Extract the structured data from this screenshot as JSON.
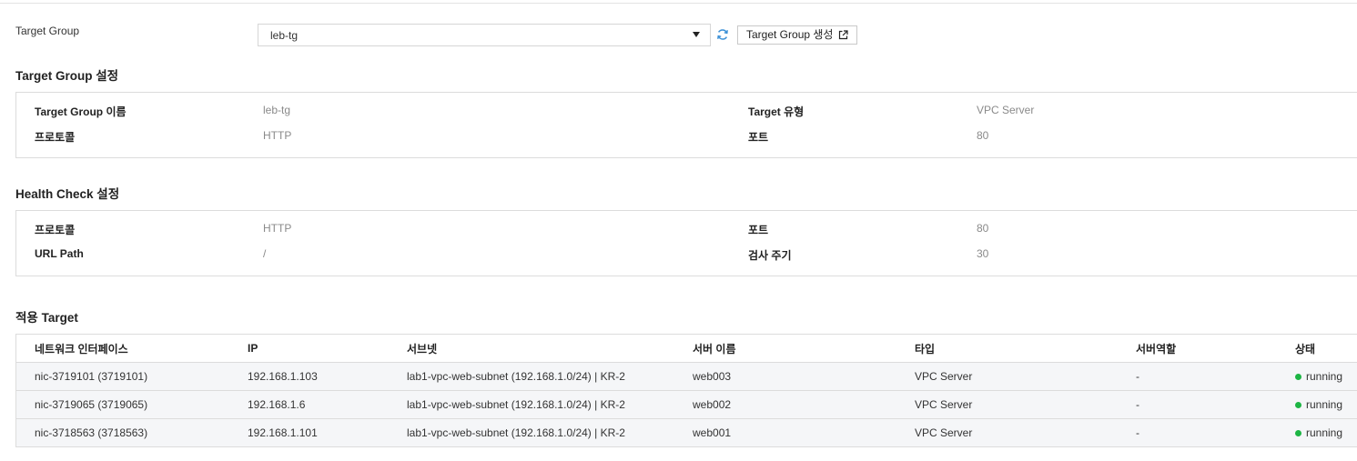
{
  "target_group_field": {
    "label": "Target Group",
    "selected": "leb-tg",
    "create_button": "Target Group 생성"
  },
  "tg_settings": {
    "title": "Target Group 설정",
    "name_label": "Target Group 이름",
    "name_value": "leb-tg",
    "type_label": "Target 유형",
    "type_value": "VPC Server",
    "protocol_label": "프로토콜",
    "protocol_value": "HTTP",
    "port_label": "포트",
    "port_value": "80"
  },
  "health_check": {
    "title": "Health Check 설정",
    "protocol_label": "프로토콜",
    "protocol_value": "HTTP",
    "port_label": "포트",
    "port_value": "80",
    "path_label": "URL Path",
    "path_value": "/",
    "interval_label": "검사 주기",
    "interval_value": "30"
  },
  "targets": {
    "title": "적용 Target",
    "columns": [
      "네트워크 인터페이스",
      "IP",
      "서브넷",
      "서버 이름",
      "타입",
      "서버역할",
      "상태"
    ],
    "rows": [
      [
        "nic-3719101 (3719101)",
        "192.168.1.103",
        "lab1-vpc-web-subnet (192.168.1.0/24) | KR-2",
        "web003",
        "VPC Server",
        "-",
        "running"
      ],
      [
        "nic-3719065 (3719065)",
        "192.168.1.6",
        "lab1-vpc-web-subnet (192.168.1.0/24) | KR-2",
        "web002",
        "VPC Server",
        "-",
        "running"
      ],
      [
        "nic-3718563 (3718563)",
        "192.168.1.101",
        "lab1-vpc-web-subnet (192.168.1.0/24) | KR-2",
        "web001",
        "VPC Server",
        "-",
        "running"
      ]
    ]
  },
  "colors": {
    "accent": "#3a8fd6",
    "status_running": "#1db544"
  }
}
